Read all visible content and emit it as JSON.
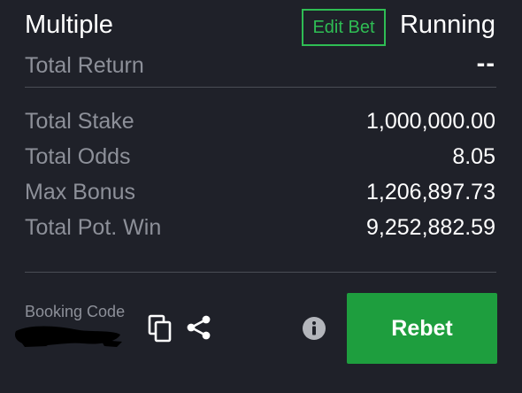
{
  "header": {
    "bet_type": "Multiple",
    "edit_bet_label": "Edit Bet",
    "status": "Running"
  },
  "total_return": {
    "label": "Total Return",
    "value": "--"
  },
  "details": [
    {
      "label": "Total Stake",
      "value": "1,000,000.00"
    },
    {
      "label": "Total Odds",
      "value": "8.05"
    },
    {
      "label": "Max Bonus",
      "value": "1,206,897.73"
    },
    {
      "label": "Total Pot. Win",
      "value": "9,252,882.59"
    }
  ],
  "footer": {
    "booking_code_label": "Booking Code",
    "rebet_label": "Rebet"
  },
  "icons": {
    "copy": "copy-icon",
    "share": "share-icon",
    "info": "info-icon"
  },
  "colors": {
    "background": "#1f2129",
    "accent": "#2fbd54",
    "rebet": "#1e9e3e",
    "label": "#8d9099"
  }
}
